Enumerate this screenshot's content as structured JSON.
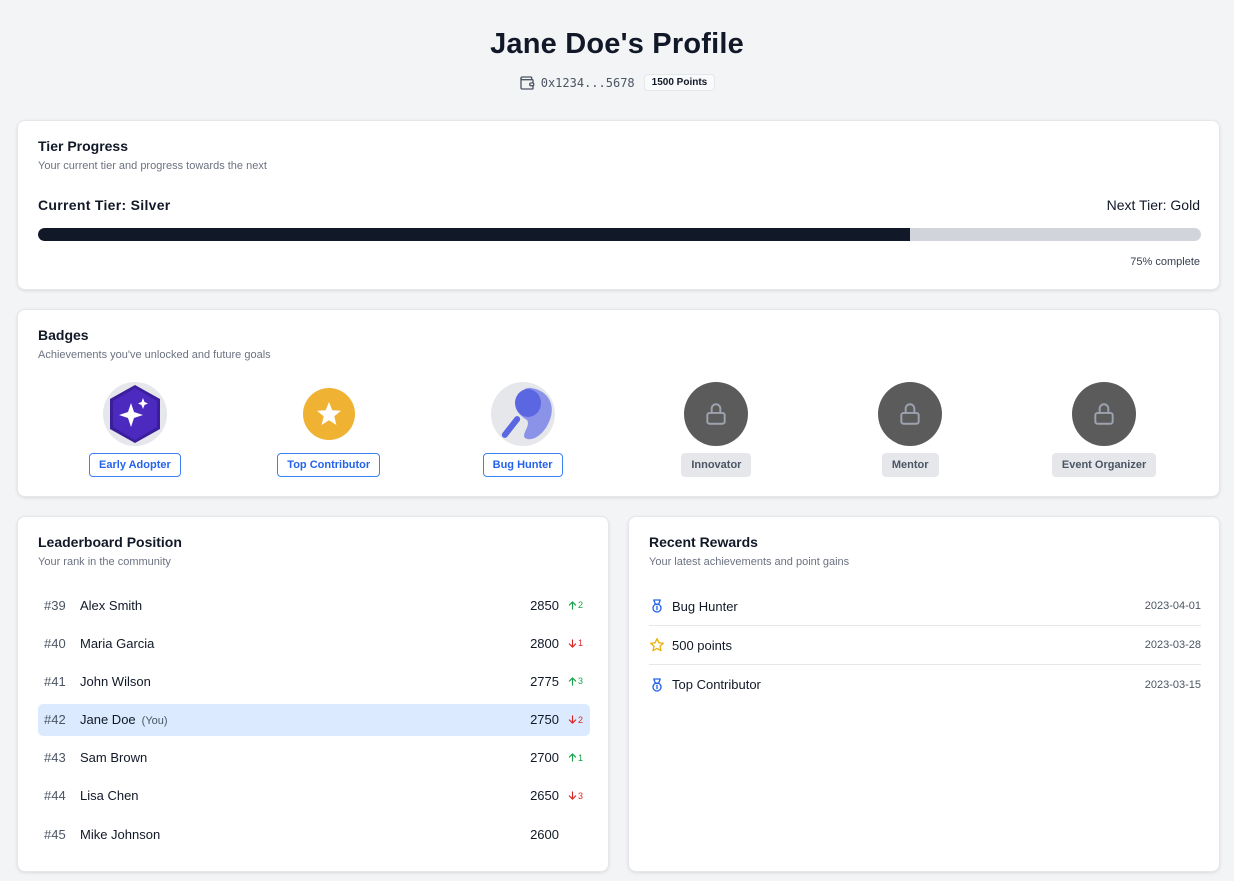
{
  "header": {
    "title": "Jane Doe's Profile",
    "wallet_icon": "wallet-icon",
    "wallet_address": "0x1234...5678",
    "points_badge": "1500 Points"
  },
  "tier": {
    "title": "Tier Progress",
    "subtitle": "Your current tier and progress towards the next",
    "current_label": "Current Tier: Silver",
    "next_label": "Next Tier: Gold",
    "progress_percent": 75,
    "progress_text": "75% complete"
  },
  "badges": {
    "title": "Badges",
    "subtitle": "Achievements you've unlocked and future goals",
    "items": [
      {
        "label": "Early Adopter",
        "unlocked": true,
        "icon": "sparkles-hexagon-icon"
      },
      {
        "label": "Top Contributor",
        "unlocked": true,
        "icon": "star-icon"
      },
      {
        "label": "Bug Hunter",
        "unlocked": true,
        "icon": "magnifier-icon"
      },
      {
        "label": "Innovator",
        "unlocked": false,
        "icon": "lock-icon"
      },
      {
        "label": "Mentor",
        "unlocked": false,
        "icon": "lock-icon"
      },
      {
        "label": "Event Organizer",
        "unlocked": false,
        "icon": "lock-icon"
      }
    ]
  },
  "leaderboard": {
    "title": "Leaderboard Position",
    "subtitle": "Your rank in the community",
    "you_label": "(You)",
    "rows": [
      {
        "rank": "#39",
        "name": "Alex Smith",
        "score": "2850",
        "direction": "up",
        "change": "2",
        "you": false
      },
      {
        "rank": "#40",
        "name": "Maria Garcia",
        "score": "2800",
        "direction": "down",
        "change": "1",
        "you": false
      },
      {
        "rank": "#41",
        "name": "John Wilson",
        "score": "2775",
        "direction": "up",
        "change": "3",
        "you": false
      },
      {
        "rank": "#42",
        "name": "Jane Doe",
        "score": "2750",
        "direction": "down",
        "change": "2",
        "you": true
      },
      {
        "rank": "#43",
        "name": "Sam Brown",
        "score": "2700",
        "direction": "up",
        "change": "1",
        "you": false
      },
      {
        "rank": "#44",
        "name": "Lisa Chen",
        "score": "2650",
        "direction": "down",
        "change": "3",
        "you": false
      },
      {
        "rank": "#45",
        "name": "Mike Johnson",
        "score": "2600",
        "direction": "",
        "change": "",
        "you": false
      }
    ]
  },
  "rewards": {
    "title": "Recent Rewards",
    "subtitle": "Your latest achievements and point gains",
    "items": [
      {
        "name": "Bug Hunter",
        "date": "2023-04-01",
        "icon": "medal-icon"
      },
      {
        "name": "500 points",
        "date": "2023-03-28",
        "icon": "star-icon"
      },
      {
        "name": "Top Contributor",
        "date": "2023-03-15",
        "icon": "medal-icon"
      }
    ]
  },
  "colors": {
    "accent": "#2563eb",
    "progress_fill": "#111827",
    "progress_track": "#d1d5db",
    "up": "#16a34a",
    "down": "#dc2626",
    "highlight_row": "#dbeafe",
    "star": "#eab308"
  }
}
